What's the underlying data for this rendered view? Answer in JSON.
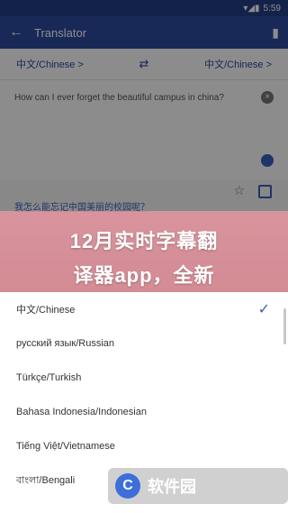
{
  "status_bar": {
    "time": "5:59"
  },
  "app_bar": {
    "title": "Translator"
  },
  "languages": {
    "source": "中文/Chinese >",
    "target": "中文/Chinese >"
  },
  "source_text": "How can I ever forget the beautiful campus in china?",
  "result_text": "我怎么能忘记中国美丽的校园呢？",
  "banner": {
    "line1": "12月实时字幕翻",
    "line2": "译器app，全新"
  },
  "language_list": [
    {
      "label": "中文/Chinese",
      "selected": true
    },
    {
      "label": "русский язык/Russian",
      "selected": false
    },
    {
      "label": "Türkçe/Turkish",
      "selected": false
    },
    {
      "label": "Bahasa Indonesia/Indonesian",
      "selected": false
    },
    {
      "label": "Tiếng Việt/Vietnamese",
      "selected": false
    },
    {
      "label": "বাংলা/Bengali",
      "selected": false
    }
  ],
  "watermark": {
    "text": "软件园"
  },
  "colors": {
    "primary": "#2c4c9e",
    "accent": "#3a5fbd",
    "banner": "#e6969f"
  }
}
